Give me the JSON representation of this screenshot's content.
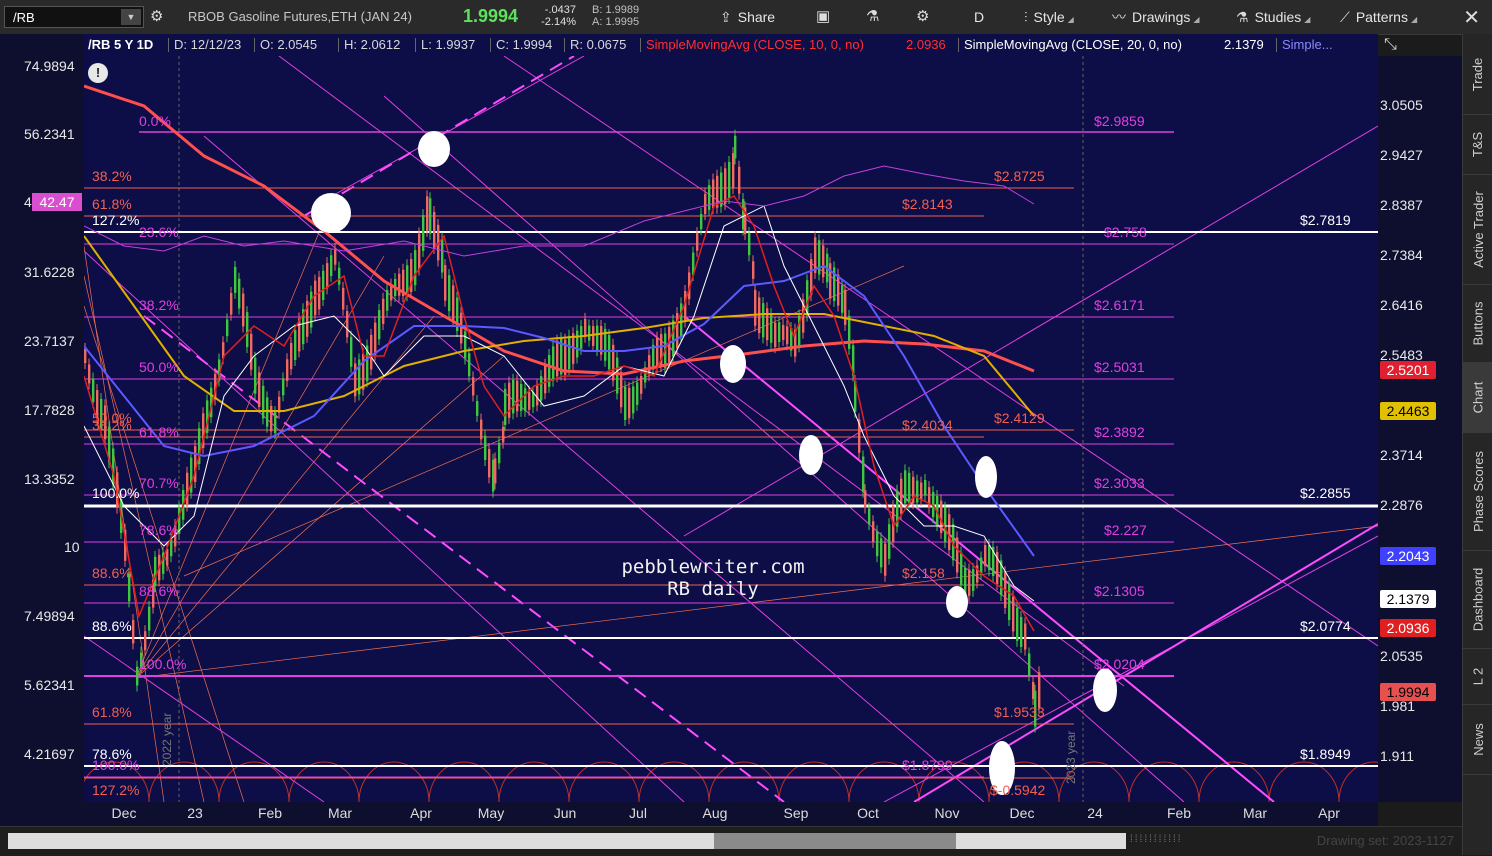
{
  "toolbar": {
    "symbol": "/RB",
    "description": "RBOB Gasoline Futures,ETH (JAN 24)",
    "last": "1.9994",
    "change": "-.0437",
    "change_pct": "-2.14%",
    "bid": "B: 1.9989",
    "ask": "A: 1.9995",
    "share": "Share",
    "aggregation": "D",
    "style": "Style",
    "drawings": "Drawings",
    "studies": "Studies",
    "patterns": "Patterns"
  },
  "infobar": {
    "symbol_period": "/RB 5 Y 1D",
    "date": "D: 12/12/23",
    "open": "O: 2.0545",
    "high": "H: 2.0612",
    "low": "L: 1.9937",
    "close": "C: 1.9994",
    "range": "R: 0.0675",
    "sma10_label": "SimpleMovingAvg (CLOSE, 10, 0, no)",
    "sma10_value": "2.0936",
    "sma20_label": "SimpleMovingAvg (CLOSE, 20, 0, no)",
    "sma20_value": "2.1379",
    "more": "Simple..."
  },
  "left_axis": [
    "74.9894",
    "56.2341",
    "42.47",
    "31.6228",
    "23.7137",
    "17.7828",
    "13.3352",
    "10",
    "7.49894",
    "5.62341",
    "4.21697"
  ],
  "left_axis_tag": "42.47",
  "right_axis": [
    "3.0505",
    "2.9427",
    "2.8387",
    "2.7384",
    "2.6416",
    "2.5483",
    "2.3714",
    "2.2876",
    "2.0535",
    "1.981",
    "1.911"
  ],
  "right_tags": {
    "sma200": "2.5201",
    "sma100": "2.4463",
    "sma50": "2.2043",
    "sma20": "2.1379",
    "sma10": "2.0936",
    "last": "1.9994"
  },
  "levels": {
    "l1": "$2.9859",
    "l2": "$2.8725",
    "l3": "$2.8143",
    "l4": "$2.7819",
    "l5": "$2.758",
    "l6": "$2.6171",
    "l7": "$2.5031",
    "l8": "$2.4129",
    "l9": "$2.4034",
    "l10": "$2.3892",
    "l11": "$2.3033",
    "l12": "$2.2855",
    "l13": "$2.227",
    "l14": "$2.158",
    "l15": "$2.1305",
    "l16": "$2.0774",
    "l17": "$2.0204",
    "l18": "$1.9533",
    "l19": "$1.8949",
    "l20": "$1.8799",
    "l21": "$-0.5942"
  },
  "fibs": {
    "f1": "0.0%",
    "f2": "38.2%",
    "f3": "61.8%",
    "f4": "127.2%",
    "f5": "23.6%",
    "f6": "38.2%",
    "f7": "50.0%",
    "f8": "50.0%",
    "f9": "38.2%",
    "f10": "61.8%",
    "f11": "70.7%",
    "f12": "100.0%",
    "f13": "78.6%",
    "f14": "88.6%",
    "f15": "88.6%",
    "f16": "88.6%",
    "f17": "100.0%",
    "f18": "61.8%",
    "f19": "78.6%",
    "f20": "100.0%",
    "f21": "127.2%"
  },
  "year_labels": {
    "y2022": "2022 year",
    "y2023": "2023 year"
  },
  "watermark": {
    "line1": "pebblewriter.com",
    "line2": "RB daily"
  },
  "x_axis": [
    "Dec",
    "23",
    "Feb",
    "Mar",
    "Apr",
    "May",
    "Jun",
    "Jul",
    "Aug",
    "Sep",
    "Oct",
    "Nov",
    "Dec",
    "24",
    "Feb",
    "Mar",
    "Apr"
  ],
  "drawing_set": "Drawing set: 2023-1127",
  "sidebar": [
    "Trade",
    "T&S",
    "Active Trader",
    "Buttons",
    "Chart",
    "Phase Scores",
    "Dashboard",
    "L 2",
    "News"
  ],
  "colors": {
    "chart_bg": "#0d0d47",
    "magenta": "#e040e0",
    "salmon": "#f06050",
    "green": "#3fc83f",
    "sma10": "#e02020",
    "sma20": "#ffffff",
    "sma50": "#5a5aff",
    "sma100": "#e0b000",
    "sma200": "#ff5050"
  }
}
